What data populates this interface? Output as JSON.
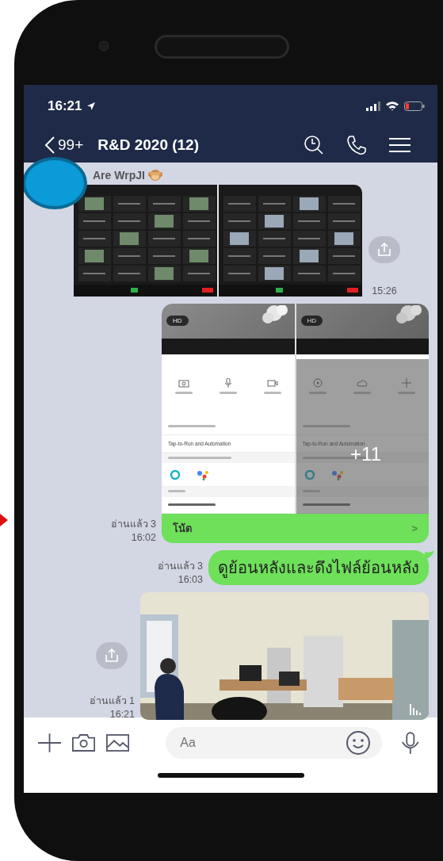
{
  "status_bar": {
    "time": "16:21",
    "battery_low": true
  },
  "header": {
    "back_label": "99+",
    "title": "R&D 2020 (12)"
  },
  "messages": [
    {
      "kind": "grid-screenshot",
      "outgoing": false,
      "sender": "Are WrpJI",
      "time": "15:26"
    },
    {
      "kind": "app-screenshot",
      "outgoing": true,
      "read": "อ่านแล้ว 3",
      "time": "16:02",
      "panels": [
        {
          "hd": "HD",
          "menu_item": "Tap-to-Run and Automation",
          "dimmed": false
        },
        {
          "hd": "HD",
          "menu_item": "Tap-to-Run and Automation",
          "dimmed": true
        }
      ],
      "more_count": "+11",
      "note_label": "โน้ต",
      "note_chevron": ">"
    },
    {
      "kind": "text",
      "outgoing": true,
      "read": "อ่านแล้ว 3",
      "time": "16:03",
      "text": "ดูย้อนหลังและดึงไฟล์ย้อนหลัง"
    },
    {
      "outgoing": true,
      "read": "อ่านแล้ว 1",
      "time": "16:21"
    }
  ],
  "composer": {
    "placeholder": "Aa"
  }
}
